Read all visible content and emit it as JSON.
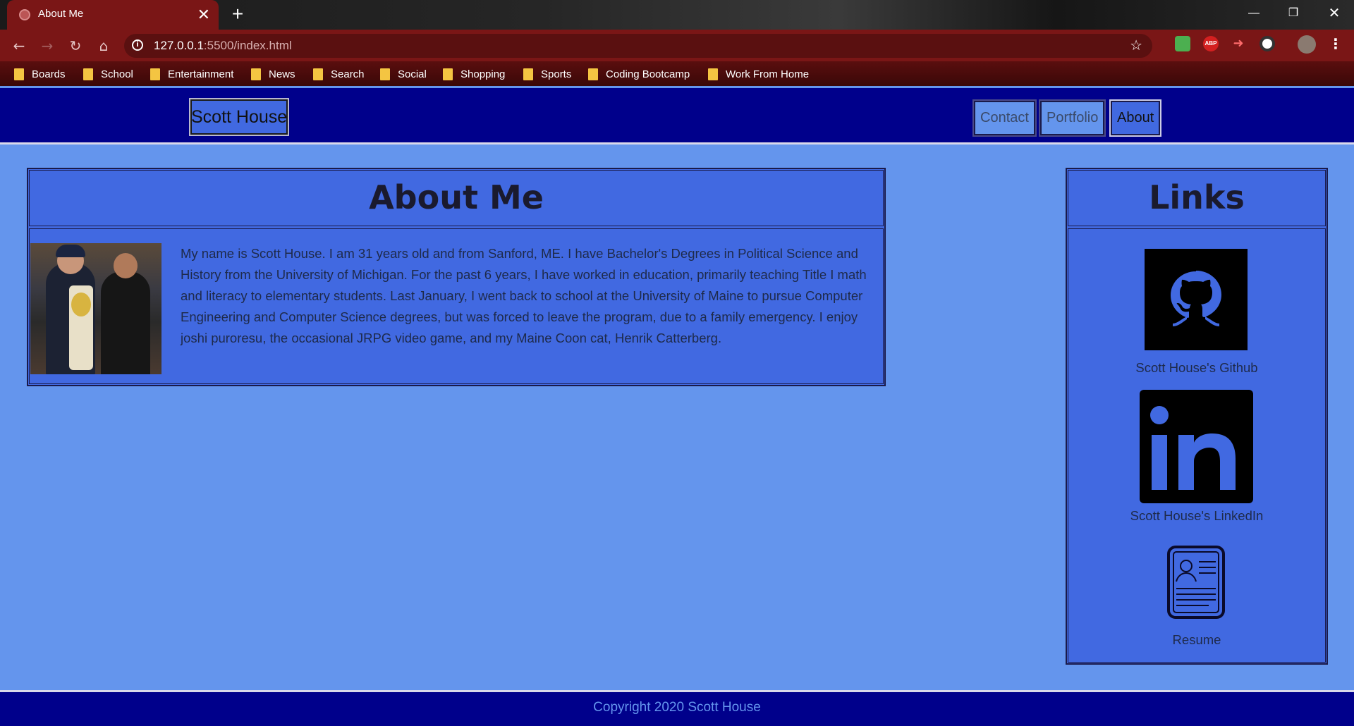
{
  "browser": {
    "tab_title": "About Me",
    "tab_close": "✕",
    "new_tab": "+",
    "url_host": "127.0.0.1",
    "url_rest": ":5500/index.html",
    "ext_abp": "ABP",
    "bookmarks": [
      {
        "label": "Boards"
      },
      {
        "label": "School"
      },
      {
        "label": "Entertainment"
      },
      {
        "label": "News"
      },
      {
        "label": "Search"
      },
      {
        "label": "Social"
      },
      {
        "label": "Shopping"
      },
      {
        "label": "Sports"
      },
      {
        "label": "Coding Bootcamp"
      },
      {
        "label": "Work From Home"
      }
    ],
    "colors": {
      "tab": "#7a1616",
      "toolbar": "#7a1616",
      "folder": "#f4c542"
    }
  },
  "site": {
    "brand": "Scott House",
    "nav": [
      {
        "label": "Contact"
      },
      {
        "label": "Portfolio"
      },
      {
        "label": "About"
      }
    ],
    "about": {
      "title": "About Me",
      "bio": "My name is Scott House. I am 31 years old and from Sanford, ME. I have Bachelor's Degrees in Political Science and History from the University of Michigan. For the past 6 years, I have worked in education, primarily teaching Title I math and literacy to elementary students. Last January, I went back to school at the University of Maine to pursue Computer Engineering and Computer Science degrees, but was forced to leave the program, due to a family emergency. I enjoy joshi puroresu, the occasional JRPG video game, and my Maine Coon cat, Henrik Catterberg."
    },
    "links": {
      "title": "Links",
      "items": [
        {
          "label": "Scott House's Github",
          "icon": "github-icon"
        },
        {
          "label": "Scott House's LinkedIn",
          "icon": "linkedin-icon"
        },
        {
          "label": "Resume",
          "icon": "resume-icon"
        }
      ]
    },
    "footer": {
      "copyright": "Copyright 2020 Scott House"
    },
    "colors": {
      "header": "#00008b",
      "page_bg": "#6495ed",
      "panel_bg": "#4169e1"
    }
  }
}
